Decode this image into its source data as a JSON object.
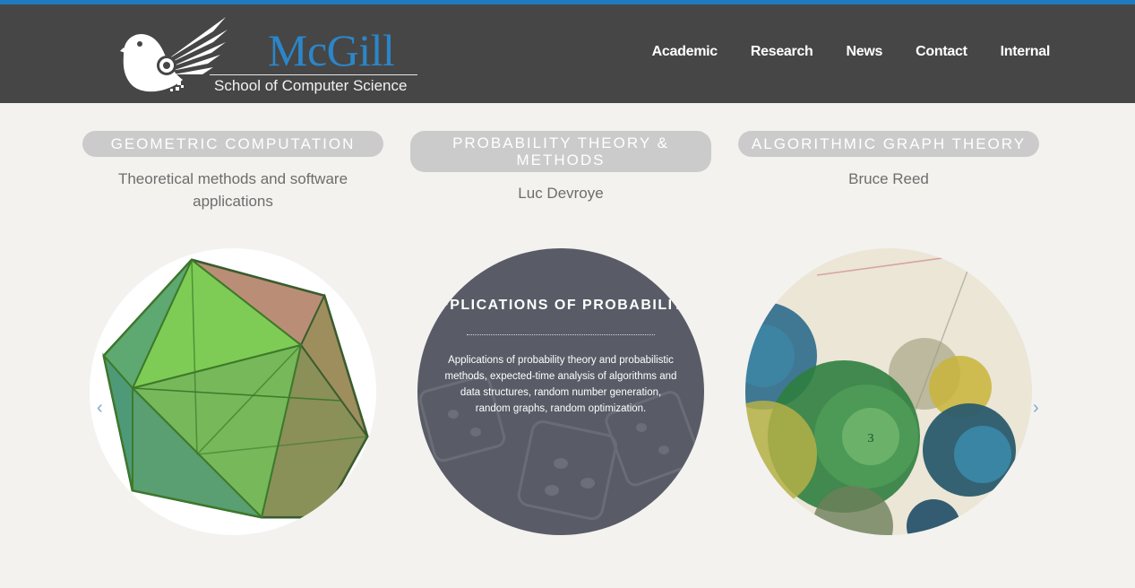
{
  "header": {
    "logo_name": "McGill",
    "logo_subtitle": "School of Computer Science",
    "nav": [
      "Academic",
      "Research",
      "News",
      "Contact",
      "Internal"
    ]
  },
  "columns": [
    {
      "pill": "GEOMETRIC COMPUTATION",
      "subtitle": "Theoretical methods and software applications"
    },
    {
      "pill": "PROBABILITY THEORY & METHODS",
      "subtitle": "Luc Devroye",
      "overlay_title": "APPLICATIONS OF PROBABILITY",
      "overlay_text": "Applications of probability theory and probabilistic methods, expected-time analysis of algorithms and data structures, random number generation, random graphs, random optimization."
    },
    {
      "pill": "ALGORITHMIC GRAPH THEORY",
      "subtitle": "Bruce Reed",
      "art_number": "3"
    }
  ],
  "carousel": {
    "prev_icon": "‹",
    "next_icon": "›"
  },
  "colors": {
    "accent": "#1e7bc0",
    "header_bg": "#464646",
    "pill_bg": "#cbcbcb",
    "page_bg": "#f3f2ef"
  }
}
